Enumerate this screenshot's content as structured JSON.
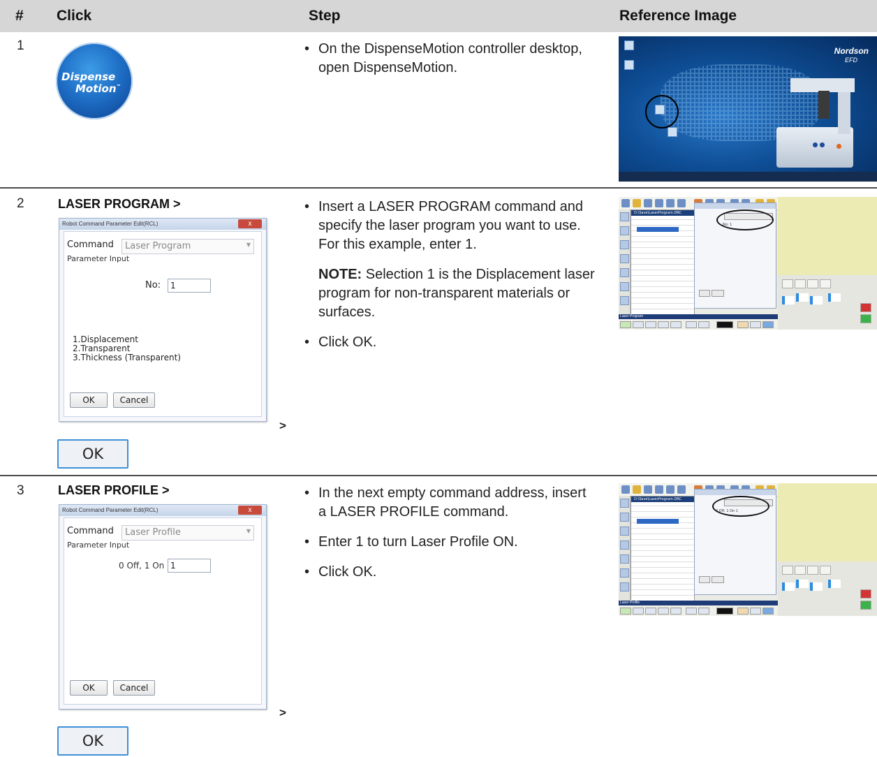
{
  "header": {
    "col_num": "#",
    "col_click": "Click",
    "col_step": "Step",
    "col_ref": "Reference Image"
  },
  "logo": {
    "line1": "Dispense",
    "line2": "Motion",
    "tm": "™"
  },
  "rows": [
    {
      "num": "1",
      "steps": [
        "On the DispenseMotion controller desktop, open DispenseMotion."
      ],
      "ref": {
        "brand": "Nordson",
        "brand_sub": "EFD"
      }
    },
    {
      "num": "2",
      "click_title": "LASER PROGRAM >",
      "dialog": {
        "title": "Robot Command Parameter Edit(RCL)",
        "close": "x",
        "command_label": "Command",
        "command_value": "Laser Program",
        "param_label": "Parameter Input",
        "field_label": "No:",
        "field_value": "1",
        "options": [
          "1.Displacement",
          "2.Transparent",
          "3.Thickness (Transparent)"
        ],
        "ok": "OK",
        "cancel": "Cancel"
      },
      "arrow": ">",
      "ok_button": "OK",
      "steps": [
        "Insert a LASER PROGRAM command and specify the laser program you want to use. For this example, enter 1.",
        "Click OK."
      ],
      "note_label": "NOTE:",
      "note_text": " Selection 1 is the Displacement laser program for non-transparent materials or surfaces.",
      "ref": {
        "title": "D:\\Save\\LaserProgram.DRC",
        "status": "Laser Program",
        "field": "No: 1"
      }
    },
    {
      "num": "3",
      "click_title": "LASER PROFILE >",
      "dialog": {
        "title": "Robot Command Parameter Edit(RCL)",
        "close": "x",
        "command_label": "Command",
        "command_value": "Laser Profile",
        "param_label": "Parameter Input",
        "field_label": "0 Off, 1 On",
        "field_value": "1",
        "ok": "OK",
        "cancel": "Cancel"
      },
      "arrow": ">",
      "ok_button": "OK",
      "steps": [
        "In the next empty command address, insert a LASER PROFILE command.",
        "Enter 1 to turn Laser Profile ON.",
        "Click OK."
      ],
      "ref": {
        "title": "D:\\Save\\LaserProgram.DRC",
        "status": "Laser Profile",
        "field": "0 Off, 1 On 1"
      }
    }
  ]
}
